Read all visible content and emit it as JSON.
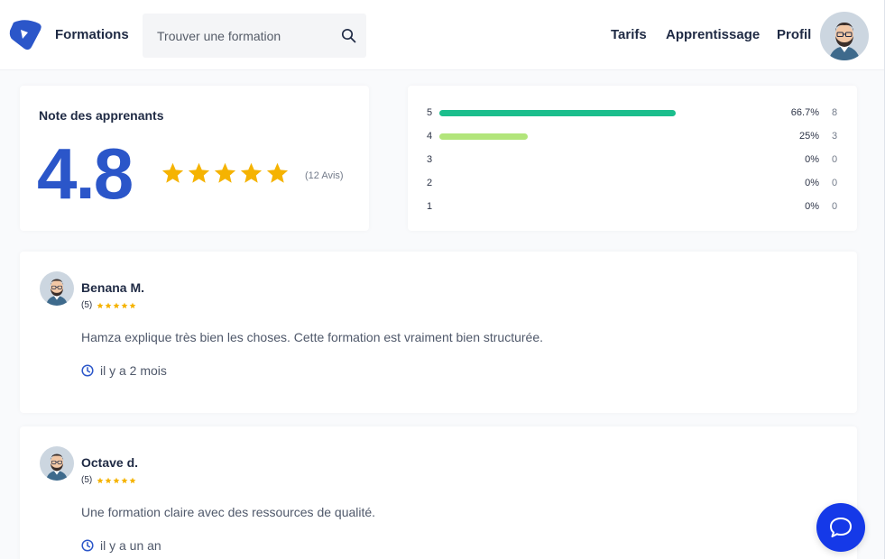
{
  "header": {
    "logo_icon": "brand-logo-icon",
    "brand": "Formations",
    "search": {
      "placeholder": "Trouver une formation",
      "icon": "search-icon"
    },
    "nav": [
      "Tarifs",
      "Apprentissage",
      "Profil"
    ],
    "avatar_icon": "avatar-icon"
  },
  "rating": {
    "title": "Note des apprenants",
    "score": "4.8",
    "stars": 5,
    "reviews": "(12 Avis)",
    "star_color": "#f5b301",
    "score_color": "#2b56c9"
  },
  "distribution": [
    {
      "label": "5",
      "fraction": 0.667,
      "pct": "66.7%",
      "count": "8",
      "bar_color": "#1bbe8c"
    },
    {
      "label": "4",
      "fraction": 0.25,
      "pct": "25%",
      "count": "3",
      "bar_color": "#b2e57b"
    },
    {
      "label": "3",
      "fraction": 0,
      "pct": "0%",
      "count": "0",
      "bar_color": "#1bbe8c"
    },
    {
      "label": "2",
      "fraction": 0,
      "pct": "0%",
      "count": "0",
      "bar_color": "#1bbe8c"
    },
    {
      "label": "1",
      "fraction": 0,
      "pct": "0%",
      "count": "0",
      "bar_color": "#1bbe8c"
    }
  ],
  "reviews": [
    {
      "name": "Benana M.",
      "score": "(5)",
      "stars": 5,
      "text": "Hamza explique très bien les choses. Cette formation est vraiment bien structurée.",
      "time": "il y a 2 mois"
    },
    {
      "name": "Octave d.",
      "score": "(5)",
      "stars": 5,
      "text": "Une formation claire avec des ressources de qualité.",
      "time": "il y a un an"
    }
  ],
  "chat": {
    "icon": "chat-bubble-icon",
    "color": "#1539e8"
  }
}
